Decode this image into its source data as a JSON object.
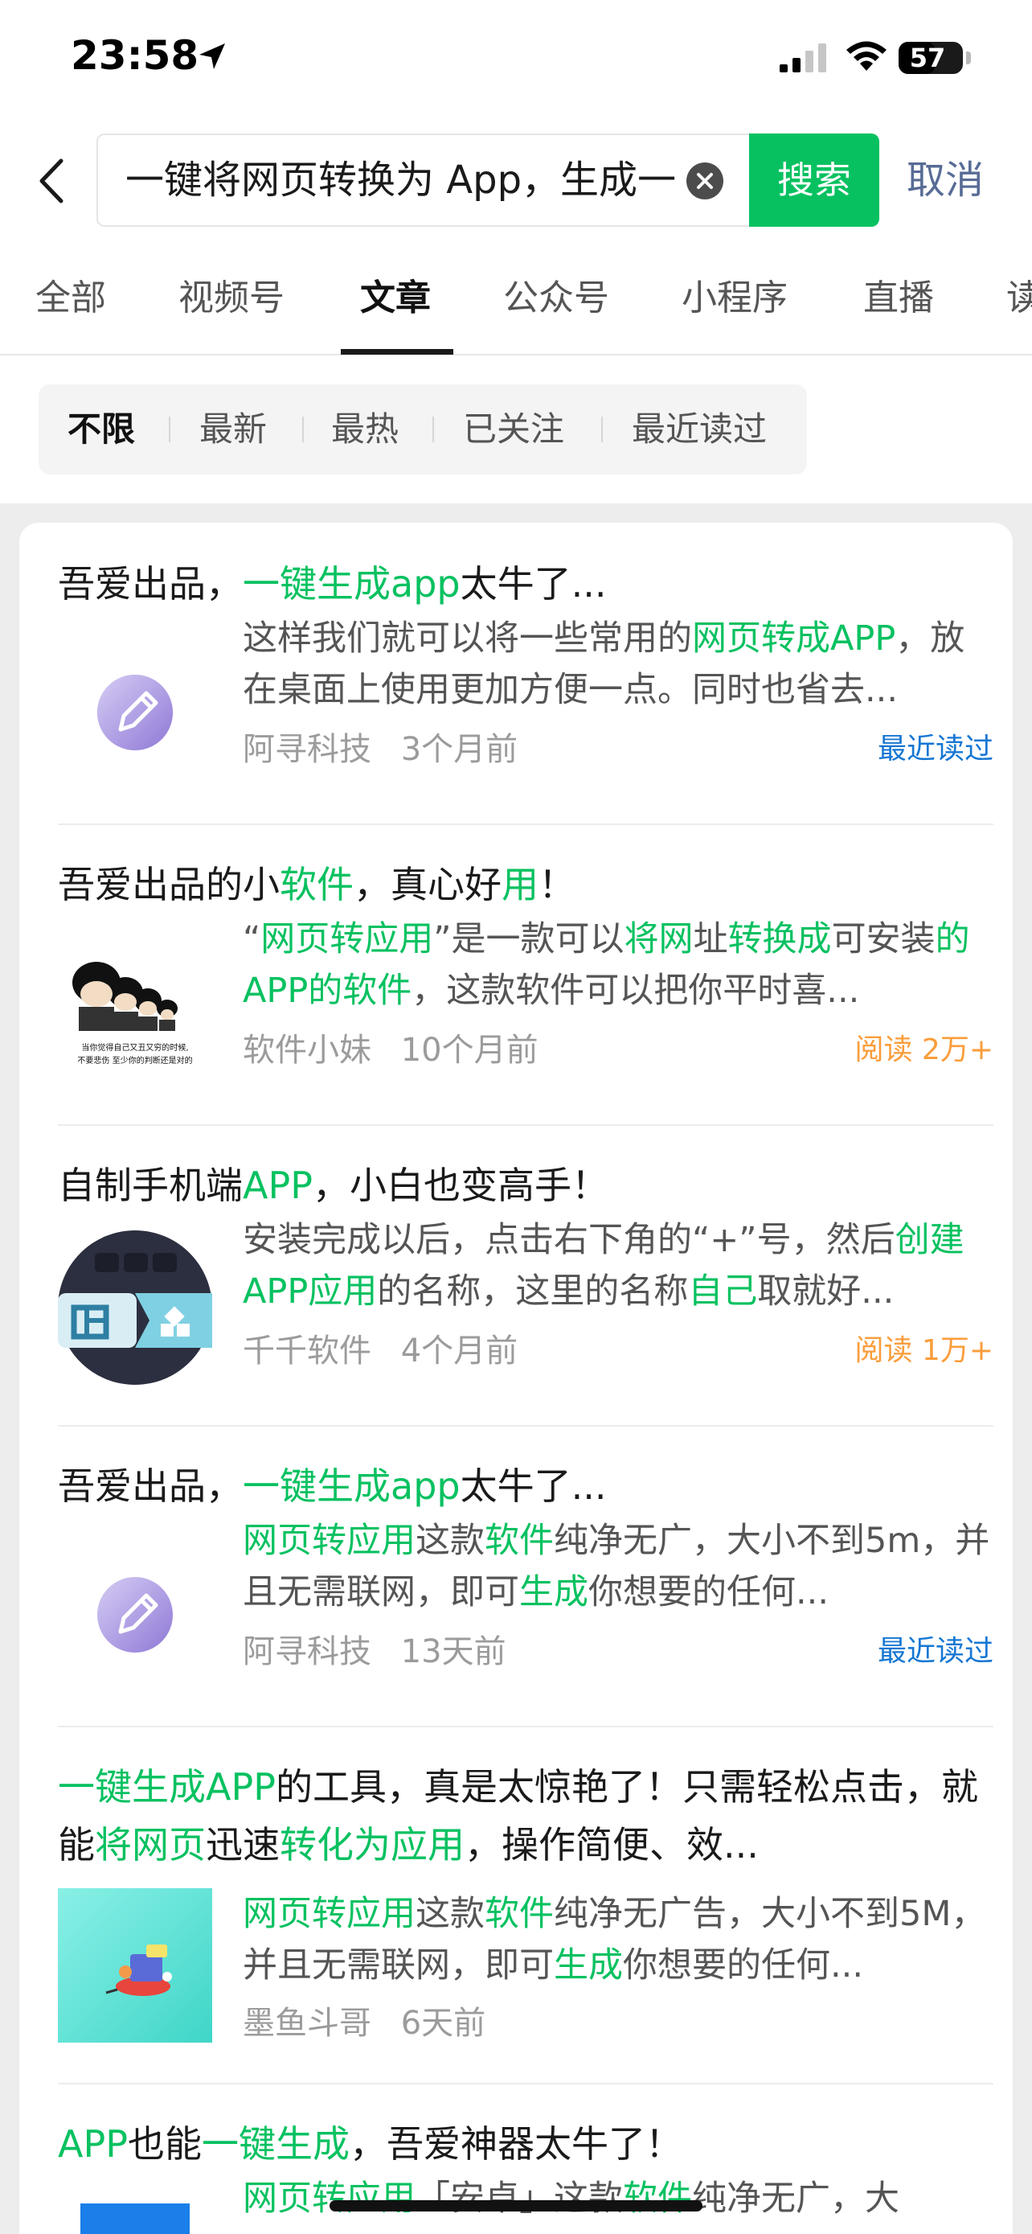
{
  "status_bar": {
    "time": "23:58",
    "battery": "57",
    "battery_fraction": 0.57
  },
  "search": {
    "query": "一键将网页转换为 App，生成一",
    "button_label": "搜索",
    "cancel_label": "取消"
  },
  "tabs": [
    "全部",
    "视频号",
    "文章",
    "公众号",
    "小程序",
    "直播",
    "读"
  ],
  "active_tab": "文章",
  "filters": [
    "不限",
    "最新",
    "最热",
    "已关注",
    "最近读过"
  ],
  "active_filter": "不限",
  "colors": {
    "accent": "#07c160",
    "link": "#576b95",
    "badge_blue": "#1677d3",
    "badge_orange": "#fa9d3b"
  },
  "results": [
    {
      "title": [
        {
          "t": "吾爱出品，"
        },
        {
          "t": "一键生成app",
          "hl": true
        },
        {
          "t": "太牛了..."
        }
      ],
      "thumb": "pencil-icon",
      "snippet": [
        {
          "t": "这样我们就可以将一些常用的"
        },
        {
          "t": "网页转成APP",
          "hl": true
        },
        {
          "t": "，放在桌面上使用更加方便一点。同时也省去..."
        }
      ],
      "source": "阿寻科技",
      "time": "3个月前",
      "badge": "最近读过",
      "badge_type": "blue"
    },
    {
      "title": [
        {
          "t": "吾爱出品的小"
        },
        {
          "t": "软件",
          "hl": true
        },
        {
          "t": "，真心好"
        },
        {
          "t": "用",
          "hl": true
        },
        {
          "t": "！"
        }
      ],
      "thumb": "meme-image",
      "thumb_caption": "当你觉得自己又丑又穷的时候，不要悲伤 至少你的判断还是对的",
      "snippet": [
        {
          "t": "“"
        },
        {
          "t": "网页转应用",
          "hl": true
        },
        {
          "t": "”是一款可以"
        },
        {
          "t": "将网",
          "hl": true
        },
        {
          "t": "址"
        },
        {
          "t": "转换成",
          "hl": true
        },
        {
          "t": "可安装"
        },
        {
          "t": "的APP的软件",
          "hl": true
        },
        {
          "t": "，这款软件可以把你平时喜..."
        }
      ],
      "source": "软件小妹",
      "time": "10个月前",
      "badge": "阅读 2万+",
      "badge_type": "orange"
    },
    {
      "title": [
        {
          "t": "自制手机端"
        },
        {
          "t": "APP",
          "hl": true
        },
        {
          "t": "，小白也变高手！"
        }
      ],
      "thumb": "app-grid-icon",
      "snippet": [
        {
          "t": "安装完成以后，点击右下角的“+”号，然后"
        },
        {
          "t": "创建APP应用",
          "hl": true
        },
        {
          "t": "的名称，这里的名称"
        },
        {
          "t": "自己",
          "hl": true
        },
        {
          "t": "取就好..."
        }
      ],
      "source": "千千软件",
      "time": "4个月前",
      "badge": "阅读 1万+",
      "badge_type": "orange"
    },
    {
      "title": [
        {
          "t": "吾爱出品，"
        },
        {
          "t": "一键生成app",
          "hl": true
        },
        {
          "t": "太牛了..."
        }
      ],
      "thumb": "pencil-icon",
      "snippet": [
        {
          "t": "网页转应用",
          "hl": true
        },
        {
          "t": "这款"
        },
        {
          "t": "软件",
          "hl": true
        },
        {
          "t": "纯净无广，大小不到5m，并且无需联网，即可"
        },
        {
          "t": "生成",
          "hl": true
        },
        {
          "t": "你想要的任何..."
        }
      ],
      "source": "阿寻科技",
      "time": "13天前",
      "badge": "最近读过",
      "badge_type": "blue"
    },
    {
      "title": [
        {
          "t": "一键生成APP",
          "hl": true
        },
        {
          "t": "的工具，真是太惊艳了！只需轻松点击，就能"
        },
        {
          "t": "将网页",
          "hl": true
        },
        {
          "t": "迅速"
        },
        {
          "t": "转化为应用",
          "hl": true
        },
        {
          "t": "，操作简便、效..."
        }
      ],
      "two_line_title": true,
      "thumb": "illustration-image",
      "snippet": [
        {
          "t": "网页转应用",
          "hl": true
        },
        {
          "t": "这款"
        },
        {
          "t": "软件",
          "hl": true
        },
        {
          "t": "纯净无广告，大小不到5M，并且无需联网，即可"
        },
        {
          "t": "生成",
          "hl": true
        },
        {
          "t": "你想要的任何..."
        }
      ],
      "source": "墨鱼斗哥",
      "time": "6天前",
      "badge": ""
    },
    {
      "title": [
        {
          "t": "APP",
          "hl": true
        },
        {
          "t": "也能"
        },
        {
          "t": "一键生成",
          "hl": true
        },
        {
          "t": "，吾爱神器太牛了！"
        }
      ],
      "thumb": "blue-thumbnail",
      "snippet": [
        {
          "t": "网页转应用",
          "hl": true
        },
        {
          "t": "「安卓」这款"
        },
        {
          "t": "软件",
          "hl": true
        },
        {
          "t": "纯净无广，大"
        }
      ],
      "source": "",
      "time": "",
      "badge": ""
    }
  ]
}
